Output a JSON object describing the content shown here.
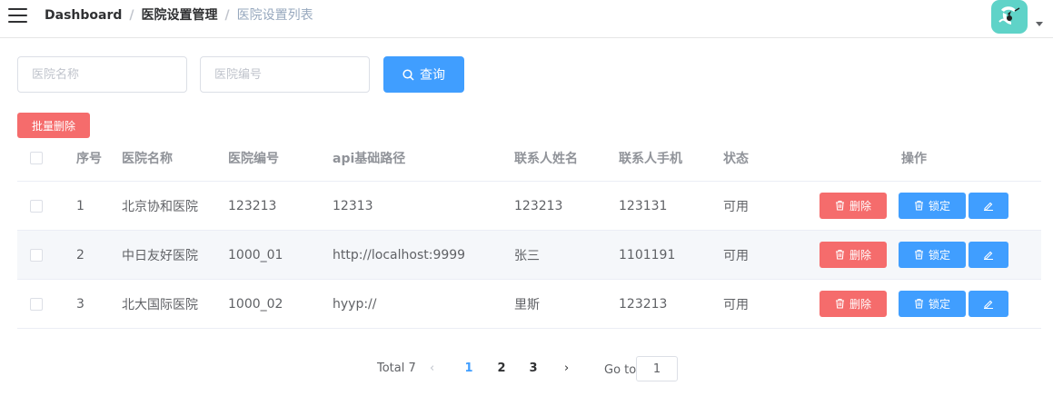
{
  "breadcrumb": [
    "Dashboard",
    "医院设置管理",
    "医院设置列表"
  ],
  "search": {
    "hosname_placeholder": "医院名称",
    "hoscode_placeholder": "医院编号",
    "query_label": "查询"
  },
  "batch_delete_label": "批量删除",
  "table": {
    "headers": {
      "index": "序号",
      "hosname": "医院名称",
      "hoscode": "医院编号",
      "api_url": "api基础路径",
      "contact_name": "联系人姓名",
      "contact_phone": "联系人手机",
      "status": "状态",
      "actions": "操作"
    },
    "rows": [
      {
        "index": "1",
        "hosname": "北京协和医院",
        "hoscode": "123213",
        "api_url": "12313",
        "contact_name": "123213",
        "contact_phone": "123131",
        "status": "可用"
      },
      {
        "index": "2",
        "hosname": "中日友好医院",
        "hoscode": "1000_01",
        "api_url": "http://localhost:9999",
        "contact_name": "张三",
        "contact_phone": "1101191",
        "status": "可用"
      },
      {
        "index": "3",
        "hosname": "北大国际医院",
        "hoscode": "1000_02",
        "api_url": "hyyp://",
        "contact_name": "里斯",
        "contact_phone": "123213",
        "status": "可用"
      }
    ],
    "delete_label": "删除",
    "lock_label": "锁定"
  },
  "pagination": {
    "total": "Total 7",
    "pages": [
      "1",
      "2",
      "3"
    ],
    "current": "1",
    "goto_label": "Go to",
    "goto_value": "1"
  },
  "colors": {
    "primary": "#409eff",
    "danger": "#f56c6c",
    "avatar_bg": "#5fd3c8"
  }
}
